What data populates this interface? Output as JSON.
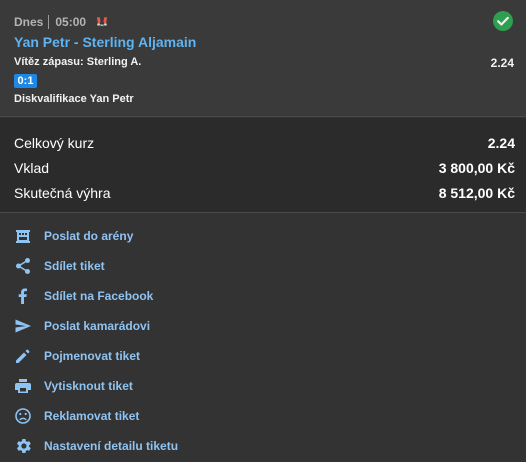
{
  "bet": {
    "day": "Dnes",
    "time": "05:00",
    "event": "Yan Petr - Sterling Aljamain",
    "market": "Vítěz zápasu: Sterling A.",
    "odd": "2.24",
    "score": "0:1",
    "result_note": "Diskvalifikace Yan Petr",
    "status_color": "#2e9e4f",
    "event_color": "#5fb3f0"
  },
  "summary": {
    "total_odds_label": "Celkový kurz",
    "total_odds_value": "2.24",
    "stake_label": "Vklad",
    "stake_value": "3 800,00 Kč",
    "win_label": "Skutečná výhra",
    "win_value": "8 512,00 Kč"
  },
  "actions": [
    {
      "label": "Poslat do arény",
      "icon": "arena-icon"
    },
    {
      "label": "Sdílet tiket",
      "icon": "share-icon"
    },
    {
      "label": "Sdílet na Facebook",
      "icon": "facebook-icon"
    },
    {
      "label": "Poslat kamarádovi",
      "icon": "send-icon"
    },
    {
      "label": "Pojmenovat tiket",
      "icon": "pencil-icon"
    },
    {
      "label": "Vytisknout tiket",
      "icon": "print-icon"
    },
    {
      "label": "Reklamovat tiket",
      "icon": "sad-face-icon"
    },
    {
      "label": "Nastavení detailu tiketu",
      "icon": "gear-icon"
    }
  ],
  "accent_color": "#8fc3f2"
}
